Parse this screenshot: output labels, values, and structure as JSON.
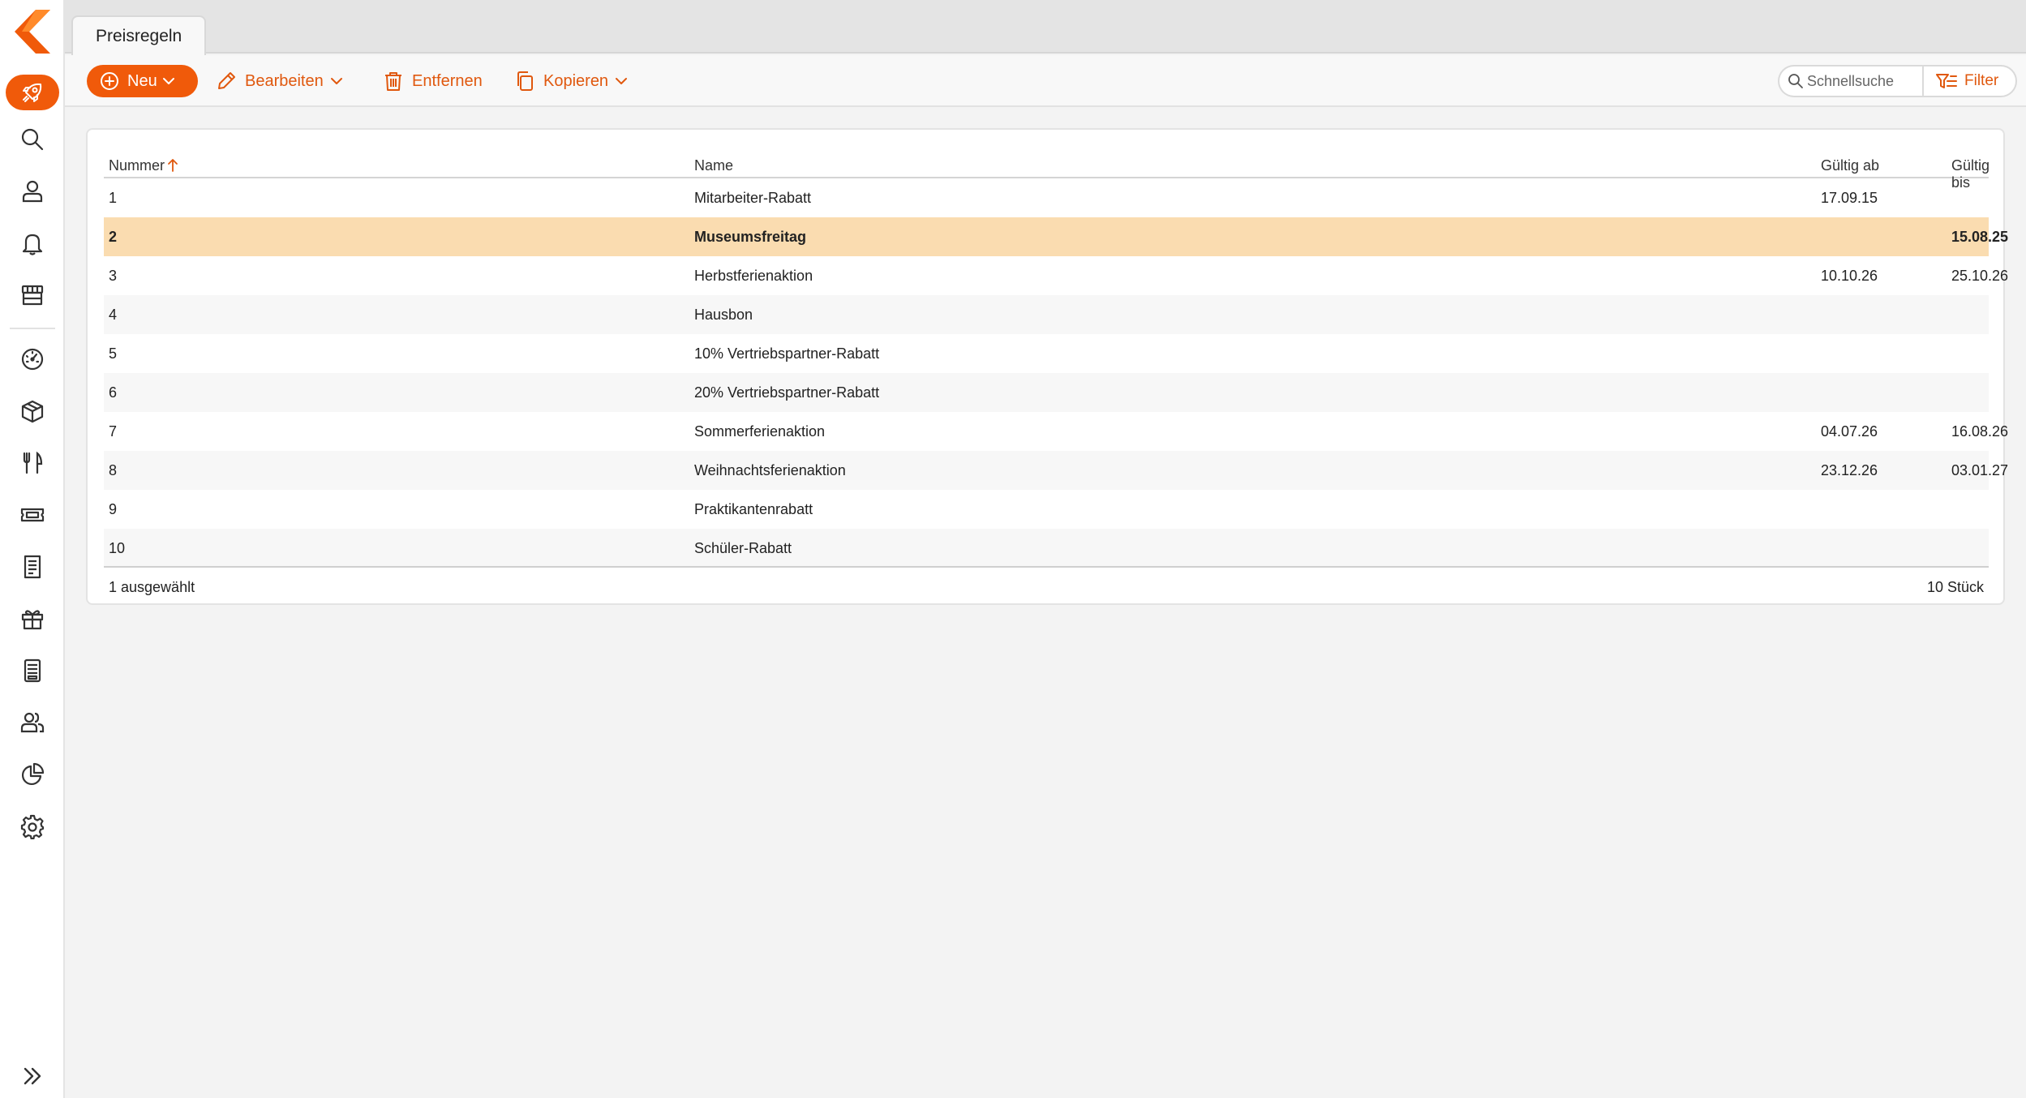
{
  "colors": {
    "accent": "#f05a0a",
    "selected_row": "#fadcb0"
  },
  "sidebar": {
    "items": [
      {
        "icon": "rocket-icon",
        "active": true
      },
      {
        "icon": "search-icon"
      },
      {
        "icon": "user-icon"
      },
      {
        "icon": "bell-icon"
      },
      {
        "icon": "store-icon"
      },
      {
        "icon": "dashboard-icon"
      },
      {
        "icon": "box-icon"
      },
      {
        "icon": "restaurant-icon"
      },
      {
        "icon": "ticket-icon"
      },
      {
        "icon": "receipt-icon"
      },
      {
        "icon": "gift-icon"
      },
      {
        "icon": "register-icon"
      },
      {
        "icon": "users-icon"
      },
      {
        "icon": "pie-chart-icon"
      },
      {
        "icon": "gear-icon"
      }
    ],
    "collapse_icon": "double-chevron-right-icon"
  },
  "tabs": [
    {
      "label": "Preisregeln",
      "active": true
    }
  ],
  "toolbar": {
    "new_label": "Neu",
    "edit_label": "Bearbeiten",
    "delete_label": "Entfernen",
    "copy_label": "Kopieren",
    "search_placeholder": "Schnellsuche",
    "filter_label": "Filter"
  },
  "table": {
    "columns": {
      "number": "Nummer",
      "name": "Name",
      "valid_from": "Gültig ab",
      "valid_to": "Gültig bis"
    },
    "sort": {
      "column": "number",
      "direction": "asc"
    },
    "rows": [
      {
        "number": "1",
        "name": "Mitarbeiter-Rabatt",
        "valid_from": "17.09.15",
        "valid_to": ""
      },
      {
        "number": "2",
        "name": "Museumsfreitag",
        "valid_from": "",
        "valid_to": "15.08.25",
        "selected": true
      },
      {
        "number": "3",
        "name": "Herbstferienaktion",
        "valid_from": "10.10.26",
        "valid_to": "25.10.26"
      },
      {
        "number": "4",
        "name": "Hausbon",
        "valid_from": "",
        "valid_to": ""
      },
      {
        "number": "5",
        "name": "10% Vertriebspartner-Rabatt",
        "valid_from": "",
        "valid_to": ""
      },
      {
        "number": "6",
        "name": "20% Vertriebspartner-Rabatt",
        "valid_from": "",
        "valid_to": ""
      },
      {
        "number": "7",
        "name": "Sommerferienaktion",
        "valid_from": "04.07.26",
        "valid_to": "16.08.26"
      },
      {
        "number": "8",
        "name": "Weihnachtsferienaktion",
        "valid_from": "23.12.26",
        "valid_to": "03.01.27"
      },
      {
        "number": "9",
        "name": "Praktikantenrabatt",
        "valid_from": "",
        "valid_to": ""
      },
      {
        "number": "10",
        "name": "Schüler-Rabatt",
        "valid_from": "",
        "valid_to": ""
      }
    ],
    "footer": {
      "selection": "1 ausgewählt",
      "count": "10 Stück"
    }
  }
}
